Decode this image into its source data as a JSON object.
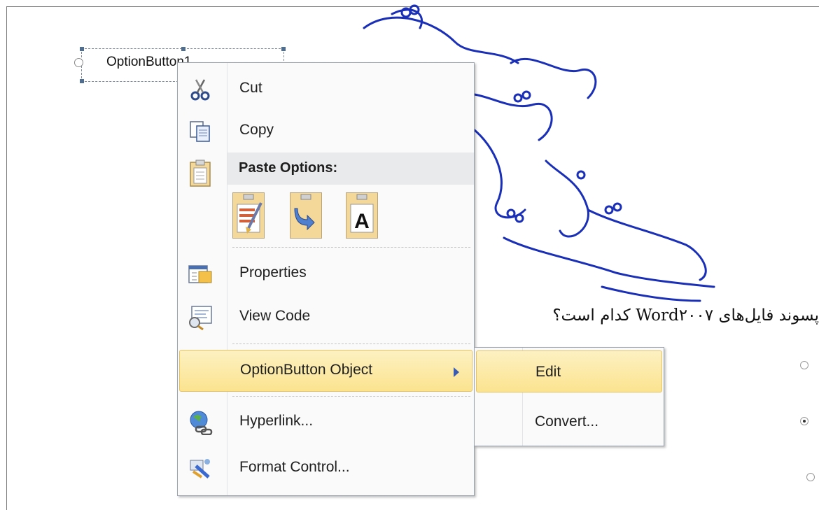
{
  "document": {
    "control_label": "OptionButton1",
    "question": "پسوند فایل‌های Word۲۰۰۷ کدام است؟",
    "options_checked": [
      false,
      true,
      false
    ]
  },
  "context_menu": {
    "cut": {
      "label": "Cut",
      "icon": "scissors-icon"
    },
    "copy": {
      "label": "Copy",
      "icon": "copy-icon"
    },
    "paste_options": {
      "label": "Paste Options:",
      "icon": "clipboard-icon"
    },
    "paste_buttons": [
      "paste-keep-formatting-icon",
      "paste-merge-icon",
      "paste-text-only-icon"
    ],
    "paste_text_glyph": "A",
    "properties": {
      "label": "Properties",
      "icon": "properties-icon"
    },
    "view_code": {
      "label": "View Code",
      "icon": "view-code-icon"
    },
    "optionbutton_object": {
      "label": "OptionButton Object"
    },
    "hyperlink": {
      "label": "Hyperlink...",
      "icon": "globe-link-icon"
    },
    "format_control": {
      "label": "Format Control...",
      "icon": "format-control-icon"
    }
  },
  "submenu": {
    "edit": {
      "label": "Edit"
    },
    "convert": {
      "label": "Convert..."
    }
  },
  "colors": {
    "highlight_top": "#fdf1c2",
    "highlight_bottom": "#fbe38f",
    "watermark": "#1a2fb8"
  }
}
